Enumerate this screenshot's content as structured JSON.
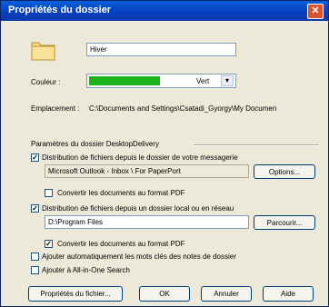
{
  "window": {
    "title": "Propriétés du dossier",
    "close_glyph": "✕"
  },
  "folder": {
    "icon": "folder-icon",
    "name": "Hiver"
  },
  "color": {
    "label": "Couleur :",
    "value": "Vert",
    "swatch": "#1db31d",
    "dropdown_glyph": "▾"
  },
  "location": {
    "label": "Emplacement :",
    "path": "C:\\Documents and Settings\\Csatadi_Gyorgy\\My Documen"
  },
  "section": {
    "title": "Paramètres du dossier DesktopDelivery"
  },
  "mail": {
    "label": "Distribution de fichiers depuis le dossier de votre messagerie",
    "checked": true,
    "source": "Microsoft Outlook -   Inbox \\ For PaperPort",
    "button": "Options...",
    "convert_label": "Convertir les documents au format PDF",
    "convert_checked": false
  },
  "local": {
    "label": "Distribution de fichiers depuis un dossier local ou en réseau",
    "checked": true,
    "path": "D:\\Program Files",
    "button": "Parcourir...",
    "convert_label": "Convertir les documents au format PDF",
    "convert_checked": true
  },
  "keywords": {
    "label": "Ajouter automatiquement les mots clés des notes de dossier",
    "checked": false
  },
  "search": {
    "label": "Ajouter à All-in-One Search",
    "checked": false
  },
  "buttons": {
    "properties": "Propriétés du fichier...",
    "ok": "OK",
    "cancel": "Annuler",
    "help": "Aide"
  },
  "check_glyph": "✓"
}
